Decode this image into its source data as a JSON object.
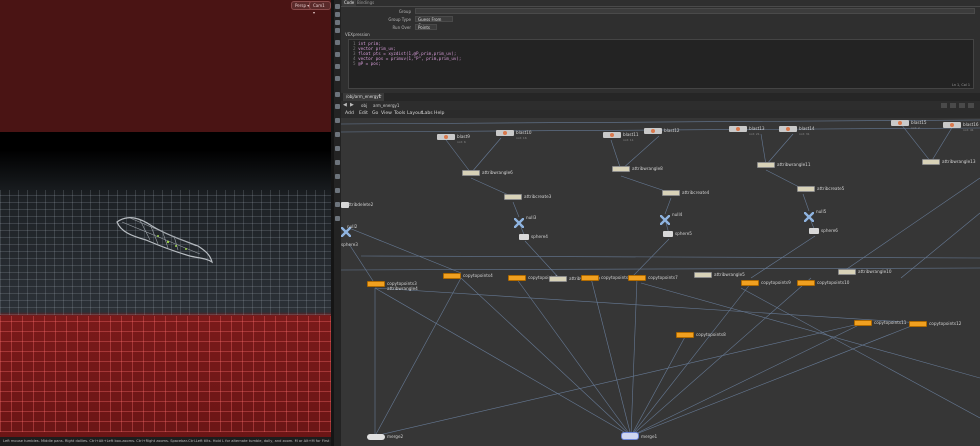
{
  "viewport": {
    "pills": [
      "Persp ▾",
      "Cam1 ▾"
    ],
    "status": "Left mouse tumbles. Middle pans. Right dollies. Ctrl+Alt+Left box-zooms. Ctrl+Right zooms. Spacebar-Ctrl-Left tilts. Hold L for alternate tumble, dolly, and zoom.    M or Alt+M for First Person Navigation."
  },
  "params": {
    "tabs": [
      "Code",
      "Bindings"
    ],
    "fields": [
      {
        "label": "Group",
        "value": ""
      },
      {
        "label": "Group Type",
        "value": "Guess From Group"
      },
      {
        "label": "Run Over",
        "value": "Points"
      }
    ],
    "section": "VEXpression",
    "code": [
      {
        "n": "1",
        "text": "int prim;"
      },
      {
        "n": "2",
        "text": "vector prim_uv;"
      },
      {
        "n": "3",
        "text": "float pts = xyzdist(1,@P,prim,prim_uv);"
      },
      {
        "n": "4",
        "text": "vector pos = primuv(1,\"P\", prim,prim_uv);"
      },
      {
        "n": "5",
        "text": "@P = pos;"
      }
    ],
    "cursor": "Ln 1, Col 1"
  },
  "network": {
    "tab": "/obj/arm_energy1",
    "path": "arm_energy1",
    "path_root": "obj",
    "menu": [
      "Add",
      "Edit",
      "Go",
      "View",
      "Tools",
      "Layout",
      "Labs",
      "Help"
    ],
    "nodes": [
      {
        "name": "blast9",
        "sub": "not: 6"
      },
      {
        "name": "blast10",
        "sub": "not: 16"
      },
      {
        "name": "blast11",
        "sub": "not: 11"
      },
      {
        "name": "blast12",
        "sub": ""
      },
      {
        "name": "blast13",
        "sub": "not: 21"
      },
      {
        "name": "blast14",
        "sub": "not: 31"
      },
      {
        "name": "blast15",
        "sub": "not: 2"
      },
      {
        "name": "blast16",
        "sub": "not: 41"
      },
      {
        "name": "attribwrangle6",
        "sub": ""
      },
      {
        "name": "attribwrangle8",
        "sub": ""
      },
      {
        "name": "attribwrangle11",
        "sub": ""
      },
      {
        "name": "attribwrangle13",
        "sub": ""
      },
      {
        "name": "attribcreate3",
        "sub": ""
      },
      {
        "name": "attribcreate4",
        "sub": ""
      },
      {
        "name": "attribcreate5",
        "sub": ""
      },
      {
        "name": "attribdelete2",
        "sub": ""
      },
      {
        "name": "null3",
        "sub": ""
      },
      {
        "name": "null4",
        "sub": ""
      },
      {
        "name": "null5",
        "sub": ""
      },
      {
        "name": "null2",
        "sub": ""
      },
      {
        "name": "sphere4",
        "sub": ""
      },
      {
        "name": "sphere5",
        "sub": ""
      },
      {
        "name": "sphere6",
        "sub": ""
      },
      {
        "name": "sphere3",
        "sub": ""
      },
      {
        "name": "copytopoints3",
        "sub": ""
      },
      {
        "name": "attribwrangle4",
        "sub": ""
      },
      {
        "name": "copytopoints4",
        "sub": ""
      },
      {
        "name": "copytopoints5",
        "sub": ""
      },
      {
        "name": "attribwrangle9",
        "sub": ""
      },
      {
        "name": "copytopoints6",
        "sub": ""
      },
      {
        "name": "copytopoints7",
        "sub": ""
      },
      {
        "name": "attribwrangle5",
        "sub": ""
      },
      {
        "name": "copytopoints9",
        "sub": ""
      },
      {
        "name": "copytopoints10",
        "sub": ""
      },
      {
        "name": "attribwrangle10",
        "sub": ""
      },
      {
        "name": "copytopoints8",
        "sub": ""
      },
      {
        "name": "copytopoints11",
        "sub": ""
      },
      {
        "name": "copytopoints12",
        "sub": ""
      },
      {
        "name": "merge2",
        "sub": ""
      },
      {
        "name": "merge1",
        "sub": ""
      }
    ]
  }
}
